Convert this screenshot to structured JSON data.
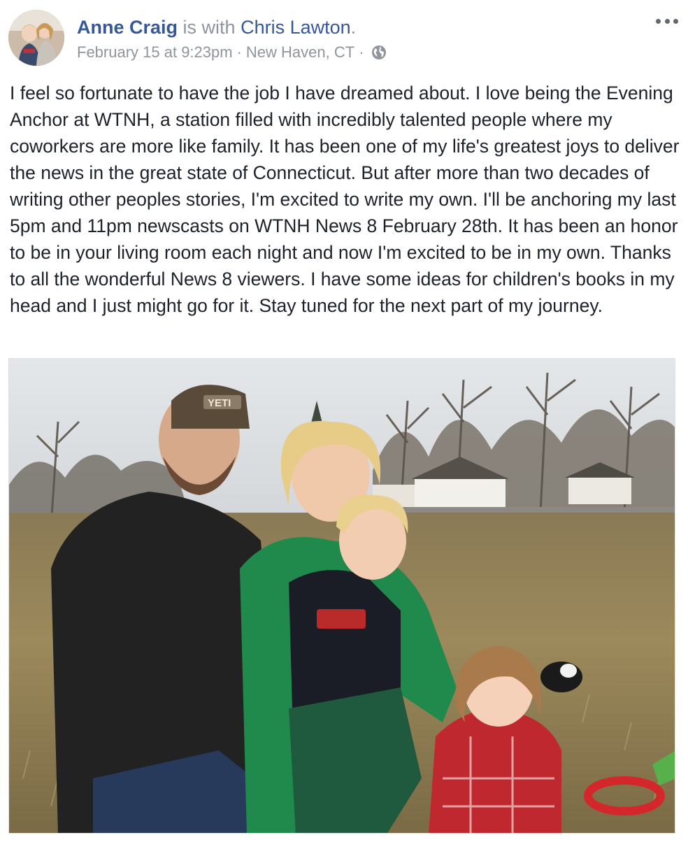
{
  "post": {
    "author": "Anne Craig",
    "with_text": "is with",
    "tagged": "Chris Lawton",
    "title_end": ".",
    "date": "February 15 at 9:23pm",
    "separator": "·",
    "location": "New Haven, CT",
    "privacy_icon": "globe-icon",
    "more_icon": "more-options-icon",
    "text": "I feel so fortunate to have the job I have dreamed about. I love being the Evening Anchor at WTNH, a station filled with incredibly talented people where my coworkers are more like family. It has been one of my life's greatest joys to deliver the news in the great state of Connecticut. But after more than two decades of writing other peoples stories, I'm excited to write my own. I'll be anchoring my last 5pm and 11pm newscasts on WTNH News 8 February 28th. It has been an honor to be in your living room each night and now I'm excited to be in my own. Thanks to all the wonderful News 8 viewers. I have some ideas for children's books in my head and I just might go for it. Stay tuned for the next part of my journey."
  },
  "photo": {
    "hat_text": "YETI"
  },
  "colors": {
    "link": "#365899",
    "meta": "#90949c",
    "text": "#1d2129"
  }
}
